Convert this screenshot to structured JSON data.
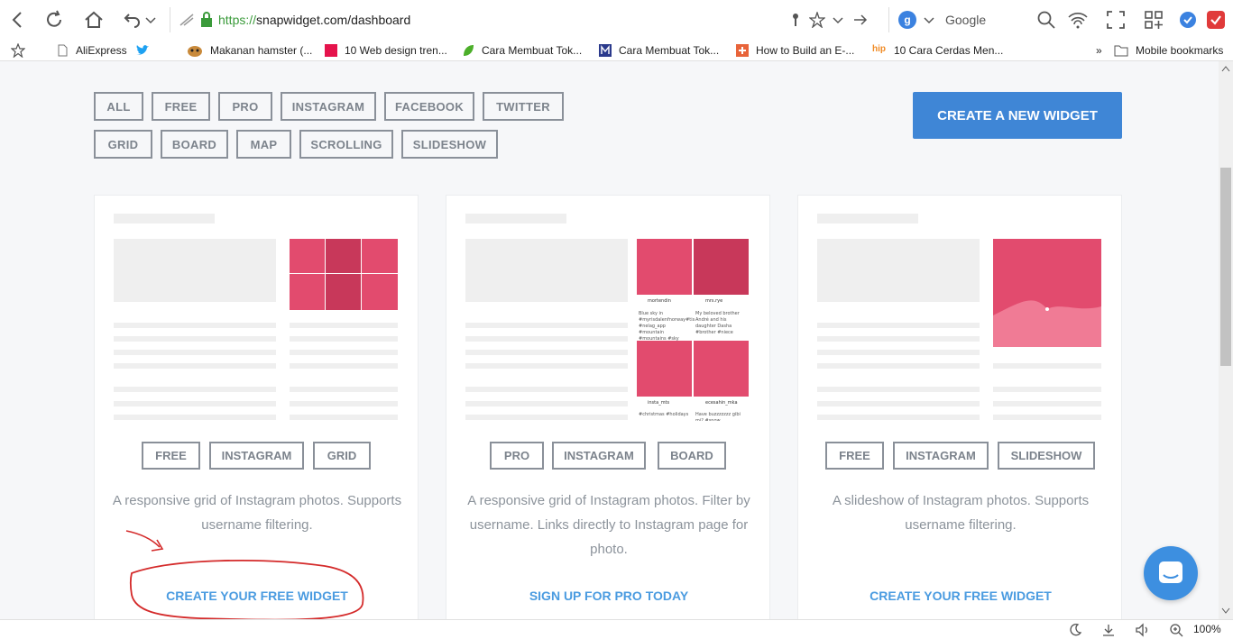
{
  "browser": {
    "url_scheme": "https://",
    "url_rest": "snapwidget.com/dashboard",
    "search_engine": "Google",
    "search_badge": "g",
    "zoom": "100%",
    "bookmarks_bar": [
      {
        "label": "AliExpress",
        "icon": "page-icon"
      },
      {
        "label": "",
        "icon": "twitter-icon"
      },
      {
        "label": "Makanan hamster (...",
        "icon": "hamster-icon"
      },
      {
        "label": "10 Web design tren...",
        "icon": "tnw-icon"
      },
      {
        "label": "Cara Membuat Tok...",
        "icon": "leaf-icon"
      },
      {
        "label": "Cara Membuat Tok...",
        "icon": "m-icon"
      },
      {
        "label": "How to Build an E-...",
        "icon": "plus-icon"
      },
      {
        "label": "10 Cara Cerdas Men...",
        "icon": "hip-icon"
      }
    ],
    "mobile_bookmarks": "Mobile bookmarks",
    "more_chevron": "»"
  },
  "filters": {
    "row1": [
      "ALL",
      "FREE",
      "PRO",
      "INSTAGRAM",
      "FACEBOOK",
      "TWITTER"
    ],
    "row2": [
      "GRID",
      "BOARD",
      "MAP",
      "SCROLLING",
      "SLIDESHOW"
    ]
  },
  "create_button": "CREATE A NEW WIDGET",
  "cards": [
    {
      "tags": [
        "FREE",
        "INSTAGRAM",
        "GRID"
      ],
      "description": "A responsive grid of Instagram photos. Supports username filtering.",
      "cta": "CREATE YOUR FREE WIDGET"
    },
    {
      "tags": [
        "PRO",
        "INSTAGRAM",
        "BOARD"
      ],
      "description": "A responsive grid of Instagram photos. Filter by username. Links directly to Instagram page for photo.",
      "cta": "SIGN UP FOR PRO TODAY",
      "preview": {
        "users": [
          "mortendin",
          "mrs.rye",
          "insta_mts",
          "ecesahin_mka"
        ],
        "captions": [
          "Blue sky in #myrisdalenfnorway#tis #nelag_app #mountain #mountains #sky #beaut",
          "My beloved brother André and his daughter Dasha #brother #niece",
          "#christmas #holidays",
          "Have buzzzzzzz gibi mi? #snow..."
        ]
      }
    },
    {
      "tags": [
        "FREE",
        "INSTAGRAM",
        "SLIDESHOW"
      ],
      "description": "A slideshow of Instagram photos. Supports username filtering.",
      "cta": "CREATE YOUR FREE WIDGET"
    }
  ],
  "colors": {
    "accent": "#3f86d6",
    "cta_link": "#4a9be0",
    "tag_border": "#8a9099",
    "pink_overlay": "#e24b6e",
    "annotation": "#d42a2a"
  }
}
